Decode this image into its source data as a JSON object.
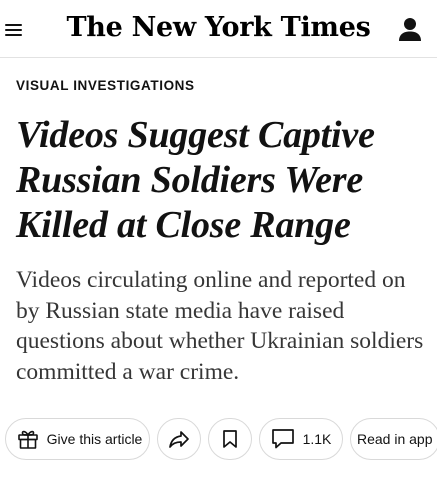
{
  "header": {
    "logo": "The New York Times",
    "menu_icon": "hamburger-menu-icon",
    "account_icon": "person-icon"
  },
  "article": {
    "kicker": "VISUAL INVESTIGATIONS",
    "headline": "Videos Suggest Captive Russian Soldiers Were Killed at Close Range",
    "summary": "Videos circulating online and reported on by Russian state media have raised questions about whether Ukrainian soldiers committed a war crime."
  },
  "actions": {
    "gift_label": "Give this article",
    "gift_icon": "gift-icon",
    "share_icon": "share-arrow-icon",
    "save_icon": "bookmark-icon",
    "comments_icon": "comment-bubble-icon",
    "comments_count": "1.1K",
    "read_in_app_label": "Read in app"
  }
}
